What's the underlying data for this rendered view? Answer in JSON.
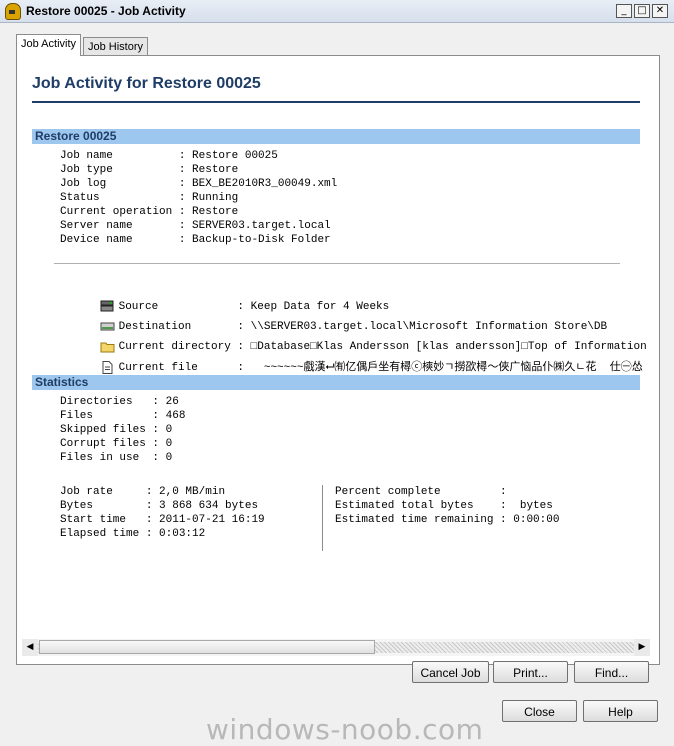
{
  "window": {
    "title": "Restore 00025 - Job Activity"
  },
  "tabs": [
    {
      "label": "Job Activity"
    },
    {
      "label": "Job History"
    }
  ],
  "page": {
    "heading": "Job Activity for Restore 00025"
  },
  "restore": {
    "section_title": "Restore 00025",
    "rows": [
      {
        "label": "Job name         ",
        "value": "Restore 00025"
      },
      {
        "label": "Job type         ",
        "value": "Restore"
      },
      {
        "label": "Job log          ",
        "value": "BEX_BE2010R3_00049.xml"
      },
      {
        "label": "Status           ",
        "value": "Running"
      },
      {
        "label": "Current operation",
        "value": "Restore"
      },
      {
        "label": "Server name      ",
        "value": "SERVER03.target.local"
      },
      {
        "label": "Device name      ",
        "value": "Backup-to-Disk Folder"
      }
    ]
  },
  "file_info": [
    {
      "icon": "server-icon",
      "label": "Source           ",
      "value": "Keep Data for 4 Weeks"
    },
    {
      "icon": "drive-icon",
      "label": "Destination      ",
      "value": "\\\\SERVER03.target.local\\Microsoft Information Store\\DB"
    },
    {
      "icon": "folder-icon",
      "label": "Current directory",
      "value": "□Database□Klas Andersson [klas andersson]□Top of Information S"
    },
    {
      "icon": "document-icon",
      "label": "Current file     ",
      "value": "  ~~~~~~戲漢⮠㈲亿偶戶坐有樳ⓒ樉妙ㄱ撈欩樳～俠广恼品仆㈱久ㄴ花  仕㊀怂"
    }
  ],
  "statistics": {
    "section_title": "Statistics",
    "counts": [
      {
        "label": "Directories  ",
        "value": "26"
      },
      {
        "label": "Files        ",
        "value": "468"
      },
      {
        "label": "Skipped files",
        "value": "0"
      },
      {
        "label": "Corrupt files",
        "value": "0"
      },
      {
        "label": "Files in use ",
        "value": "0"
      }
    ],
    "left": [
      {
        "label": "Job rate    ",
        "value": "2,0 MB/min"
      },
      {
        "label": "Bytes       ",
        "value": "3 868 634 bytes"
      },
      {
        "label": "Start time  ",
        "value": "2011-07-21 16:19"
      },
      {
        "label": "Elapsed time",
        "value": "0:03:12"
      }
    ],
    "right": [
      {
        "label": "Percent complete        ",
        "value": ""
      },
      {
        "label": "Estimated total bytes   ",
        "value": " bytes"
      },
      {
        "label": "Estimated time remaining",
        "value": "0:00:00"
      }
    ]
  },
  "actions": {
    "cancel": "Cancel Job",
    "print": "Print...",
    "find": "Find..."
  },
  "footer": {
    "close": "Close",
    "help": "Help"
  },
  "watermark": "windows-noob.com"
}
